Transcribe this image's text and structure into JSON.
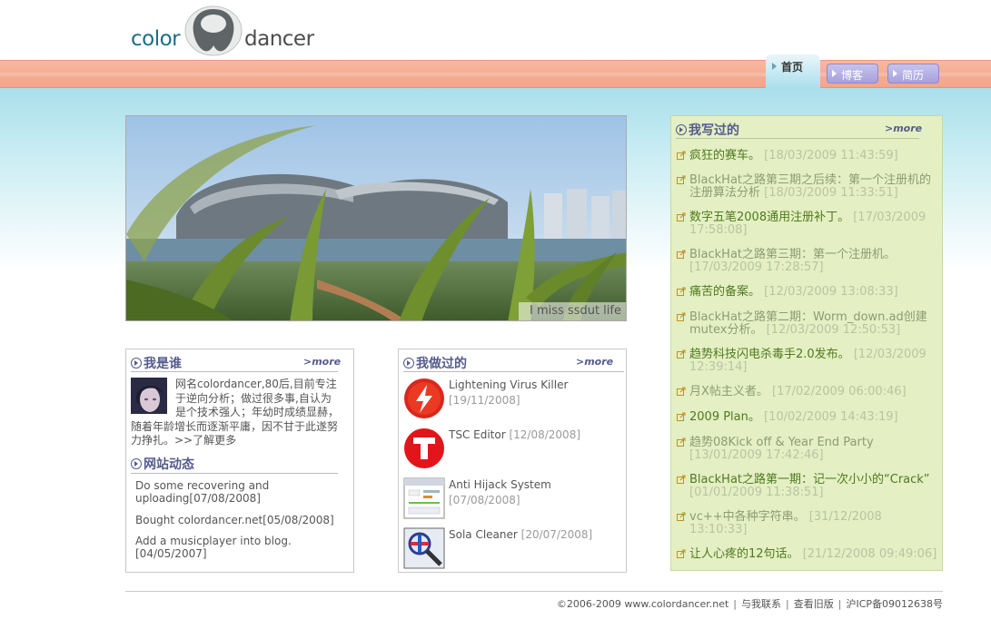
{
  "logo": {
    "word1": "color",
    "word2": "dancer"
  },
  "nav": {
    "active": "首页",
    "items": [
      {
        "label": "博客"
      },
      {
        "label": "简历"
      }
    ]
  },
  "hero": {
    "caption": "I miss ssdut life"
  },
  "who": {
    "title": "我是谁",
    "more": ">more",
    "bio": "网名colordancer,80后,目前专注于逆向分析；做过很多事,自认为是个技术强人；年幼时成绩显赫，随着年龄增长而逐渐平庸，因不甘于此遂努力挣扎。>>了解更多"
  },
  "news": {
    "title": "网站动态",
    "items": [
      {
        "text": "Do some recovering and uploading[07/08/2008]"
      },
      {
        "text": "Bought colordancer.net[05/08/2008]"
      },
      {
        "text": "Add a musicplayer into blog.[04/05/2007]"
      }
    ]
  },
  "projects": {
    "title": "我做过的",
    "more": ">more",
    "items": [
      {
        "name": "Lightening Virus Killer",
        "date": "[19/11/2008]",
        "icon": "lightning-icon"
      },
      {
        "name": "TSC Editor",
        "date": "[12/08/2008]",
        "icon": "t-logo-icon"
      },
      {
        "name": "Anti Hijack System",
        "date": "[07/08/2008]",
        "icon": "window-icon"
      },
      {
        "name": "Sola Cleaner",
        "date": "[20/07/2008]",
        "icon": "magnifier-icon"
      }
    ]
  },
  "blog": {
    "title": "我写过的",
    "more": ">more",
    "items": [
      {
        "title": "疯狂的赛车。",
        "date": "[18/03/2009 11:43:59]"
      },
      {
        "title": "BlackHat之路第三期之后续：第一个注册机的注册算法分析",
        "date": "[18/03/2009 11:33:51]"
      },
      {
        "title": "数字五笔2008通用注册补丁。",
        "date": "[17/03/2009 17:58:08]"
      },
      {
        "title": "BlackHat之路第三期：第一个注册机。",
        "date": "[17/03/2009 17:28:57]"
      },
      {
        "title": "痛苦的备案。",
        "date": "[12/03/2009 13:08:33]"
      },
      {
        "title": "BlackHat之路第二期：Worm_down.ad创建mutex分析。",
        "date": "[12/03/2009 12:50:53]"
      },
      {
        "title": "趋势科技闪电杀毒手2.0发布。",
        "date": "[12/03/2009 12:39:14]"
      },
      {
        "title": "月X帖主义者。",
        "date": "[17/02/2009 06:00:46]"
      },
      {
        "title": "2009 Plan。",
        "date": "[10/02/2009 14:43:19]"
      },
      {
        "title": "趋势08Kick off & Year End Party",
        "date": "[13/01/2009 17:42:46]"
      },
      {
        "title": "BlackHat之路第一期：记一次小小的“Crack”",
        "date": "[01/01/2009 11:38:51]"
      },
      {
        "title": "vc++中各种字符串。",
        "date": "[31/12/2008 13:10:33]"
      },
      {
        "title": "让人心疼的12句话。",
        "date": "[21/12/2008 09:49:06]"
      }
    ]
  },
  "footer": {
    "copyright": "©2006-2009 www.colordancer.net",
    "links": [
      "与我联系",
      "查看旧版",
      "沪ICP备09012638号"
    ]
  }
}
